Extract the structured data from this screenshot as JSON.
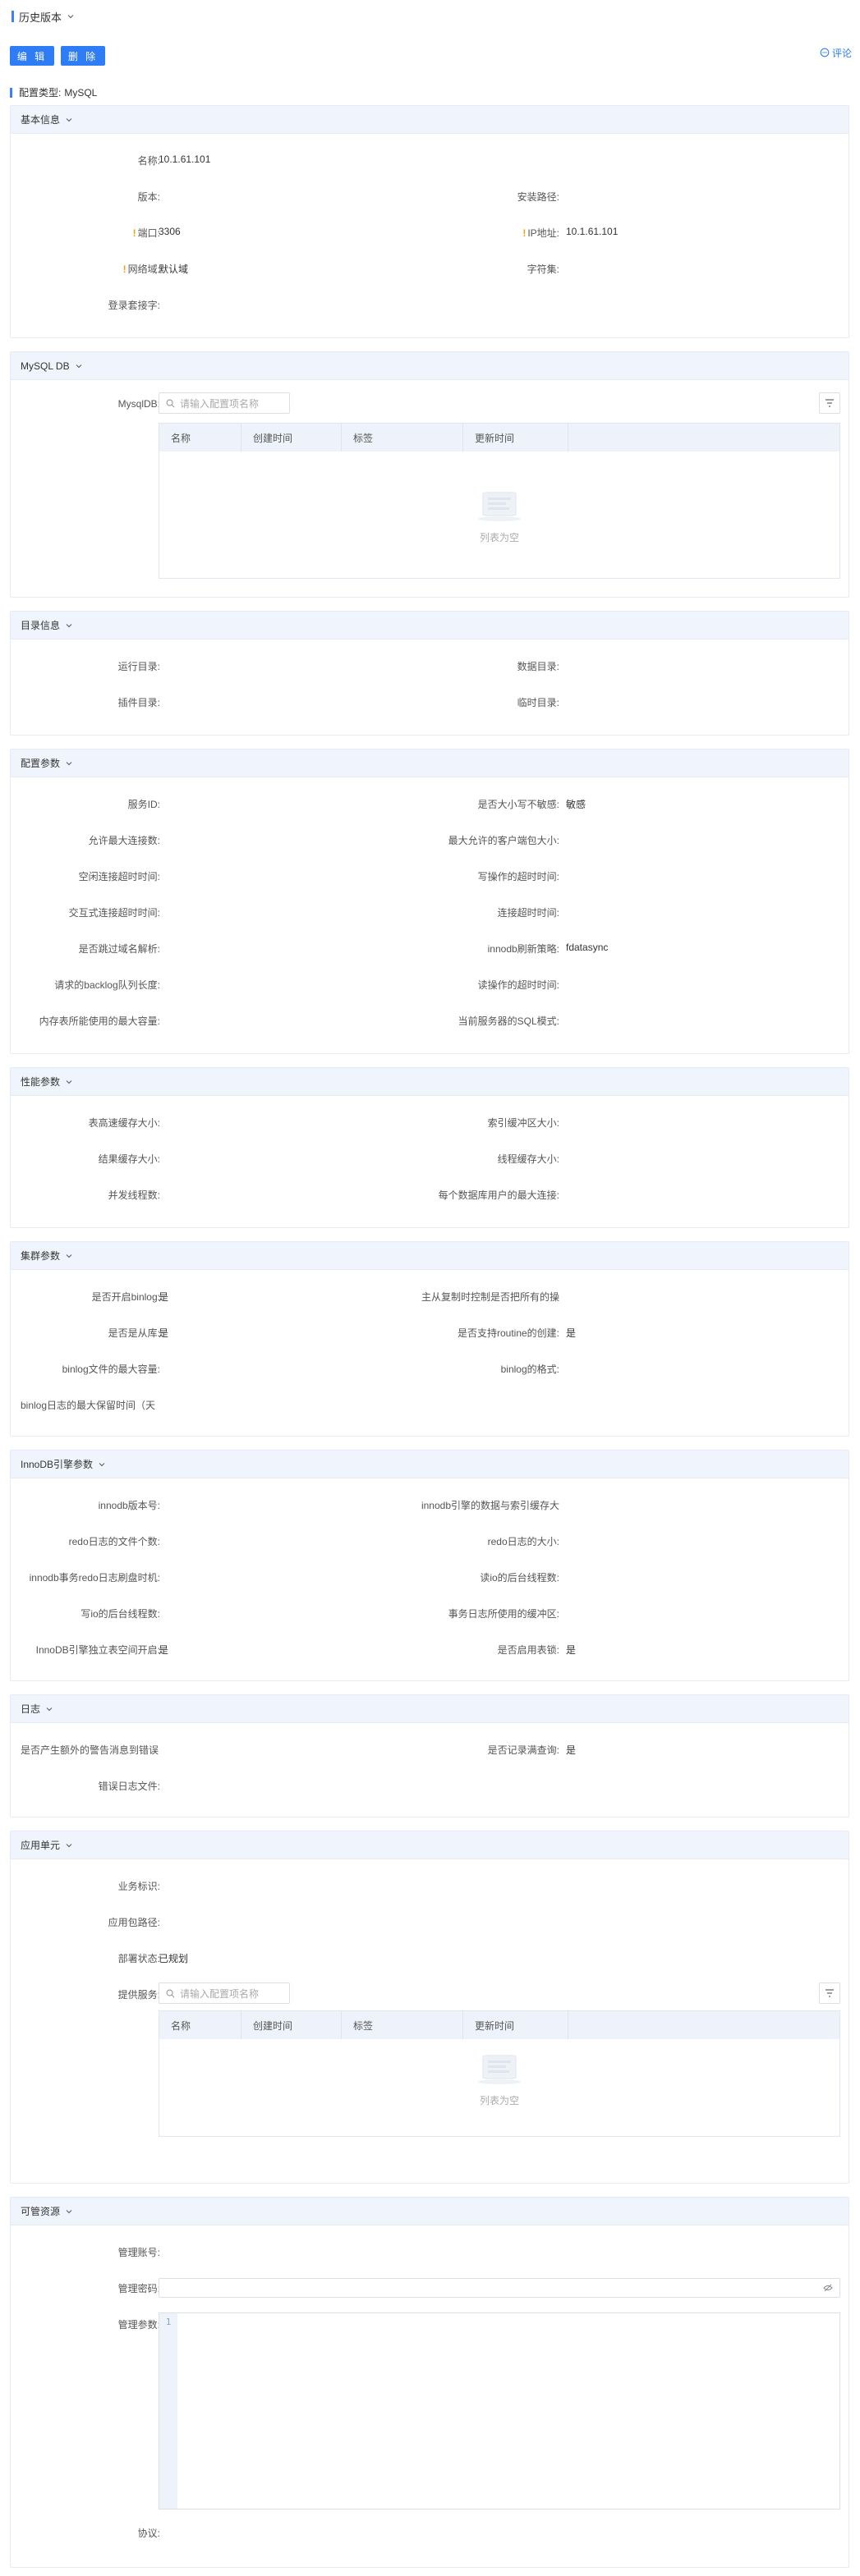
{
  "header": {
    "title": "历史版本",
    "comment": "评论"
  },
  "toolbar": {
    "edit": "编 辑",
    "delete": "删 除"
  },
  "config_type": {
    "label": "配置类型:",
    "value": "MySQL"
  },
  "basic": {
    "title": "基本信息",
    "name_label": "名称:",
    "name_value": "10.1.61.101",
    "version_label": "版本:",
    "install_path_label": "安装路径:",
    "port_label": "端口:",
    "port_value": "3306",
    "ip_label": "IP地址:",
    "ip_value": "10.1.61.101",
    "domain_label": "网络域:",
    "domain_value": "默认域",
    "charset_label": "字符集:",
    "socket_label": "登录套接字:"
  },
  "mysqldb": {
    "title": "MySQL DB",
    "field_label": "MysqlDB:",
    "search_placeholder": "请输入配置项名称",
    "columns": [
      "名称",
      "创建时间",
      "标签",
      "更新时间"
    ],
    "empty": "列表为空"
  },
  "dirs": {
    "title": "目录信息",
    "run_label": "运行目录:",
    "data_label": "数据目录:",
    "plugin_label": "插件目录:",
    "tmp_label": "临时目录:"
  },
  "config": {
    "title": "配置参数",
    "rows": [
      [
        "服务ID:",
        "",
        "是否大小写不敏感:",
        "敏感"
      ],
      [
        "允许最大连接数:",
        "",
        "最大允许的客户端包大小:",
        ""
      ],
      [
        "空闲连接超时时间:",
        "",
        "写操作的超时时间:",
        ""
      ],
      [
        "交互式连接超时时间:",
        "",
        "连接超时时间:",
        ""
      ],
      [
        "是否跳过域名解析:",
        "",
        "innodb刷新策略:",
        "fdatasync"
      ],
      [
        "请求的backlog队列长度:",
        "",
        "读操作的超时时间:",
        ""
      ],
      [
        "内存表所能使用的最大容量:",
        "",
        "当前服务器的SQL模式:",
        ""
      ]
    ]
  },
  "perf": {
    "title": "性能参数",
    "rows": [
      [
        "表高速缓存大小:",
        "",
        "索引缓冲区大小:",
        ""
      ],
      [
        "结果缓存大小:",
        "",
        "线程缓存大小:",
        ""
      ],
      [
        "并发线程数:",
        "",
        "每个数据库用户的最大连接:",
        ""
      ]
    ]
  },
  "cluster": {
    "title": "集群参数",
    "rows": [
      [
        "是否开启binlog:",
        "是",
        "主从复制时控制是否把所有的操",
        ""
      ],
      [
        "是否是从库:",
        "是",
        "是否支持routine的创建:",
        "是"
      ],
      [
        "binlog文件的最大容量:",
        "",
        "binlog的格式:",
        ""
      ]
    ],
    "last_label": "binlog日志的最大保留时间（天"
  },
  "innodb": {
    "title": "InnoDB引擎参数",
    "rows": [
      [
        "innodb版本号:",
        "",
        "innodb引擎的数据与索引缓存大",
        ""
      ],
      [
        "redo日志的文件个数:",
        "",
        "redo日志的大小:",
        ""
      ],
      [
        "innodb事务redo日志刷盘时机:",
        "",
        "读io的后台线程数:",
        ""
      ],
      [
        "写io的后台线程数:",
        "",
        "事务日志所使用的缓冲区:",
        ""
      ],
      [
        "InnoDB引擎独立表空间开启:",
        "是",
        "是否启用表锁:",
        "是"
      ]
    ]
  },
  "log": {
    "title": "日志",
    "warn_label": "是否产生额外的警告消息到错误",
    "slow_label": "是否记录满查询:",
    "slow_value": "是",
    "err_label": "错误日志文件:"
  },
  "app": {
    "title": "应用单元",
    "biz_label": "业务标识:",
    "pkg_label": "应用包路径:",
    "deploy_label": "部署状态:",
    "deploy_value": "已规划",
    "svc_label": "提供服务:",
    "search_placeholder": "请输入配置项名称",
    "columns": [
      "名称",
      "创建时间",
      "标签",
      "更新时间"
    ],
    "empty": "列表为空"
  },
  "mgmt": {
    "title": "可管资源",
    "account_label": "管理账号:",
    "password_label": "管理密码:",
    "params_label": "管理参数:",
    "line_no": "1",
    "protocol_label": "协议:"
  }
}
